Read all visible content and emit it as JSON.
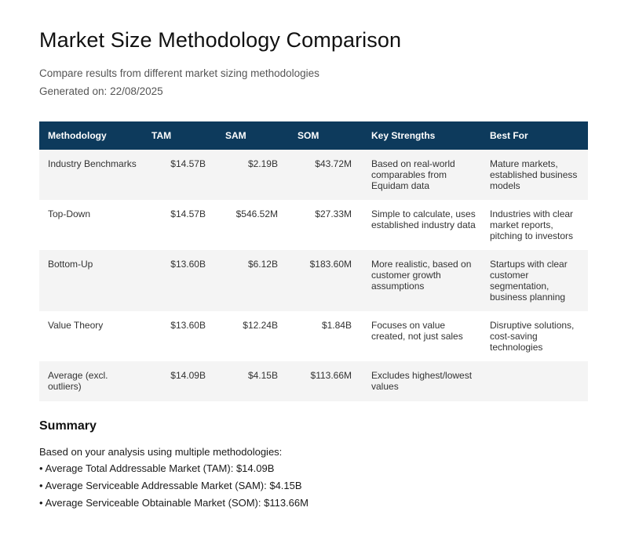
{
  "title": "Market Size Methodology Comparison",
  "subtitle": "Compare results from different market sizing methodologies",
  "generated": "Generated on: 22/08/2025",
  "table": {
    "headers": [
      "Methodology",
      "TAM",
      "SAM",
      "SOM",
      "Key Strengths",
      "Best For"
    ],
    "rows": [
      {
        "methodology": "Industry Benchmarks",
        "tam": "$14.57B",
        "sam": "$2.19B",
        "som": "$43.72M",
        "strengths": "Based on real-world comparables from Equidam data",
        "best_for": "Mature markets, established business models"
      },
      {
        "methodology": "Top-Down",
        "tam": "$14.57B",
        "sam": "$546.52M",
        "som": "$27.33M",
        "strengths": "Simple to calculate, uses established industry data",
        "best_for": "Industries with clear market reports, pitching to investors"
      },
      {
        "methodology": "Bottom-Up",
        "tam": "$13.60B",
        "sam": "$6.12B",
        "som": "$183.60M",
        "strengths": "More realistic, based on customer growth assumptions",
        "best_for": "Startups with clear customer segmentation, business planning"
      },
      {
        "methodology": "Value Theory",
        "tam": "$13.60B",
        "sam": "$12.24B",
        "som": "$1.84B",
        "strengths": "Focuses on value created, not just sales",
        "best_for": "Disruptive solutions, cost-saving technologies"
      },
      {
        "methodology": "Average (excl. outliers)",
        "tam": "$14.09B",
        "sam": "$4.15B",
        "som": "$113.66M",
        "strengths": "Excludes highest/lowest values",
        "best_for": ""
      }
    ]
  },
  "summary": {
    "heading": "Summary",
    "intro": "Based on your analysis using multiple methodologies:",
    "items": [
      "• Average Total Addressable Market (TAM): $14.09B",
      "• Average Serviceable Addressable Market (SAM): $4.15B",
      "• Average Serviceable Obtainable Market (SOM): $113.66M"
    ]
  },
  "colors": {
    "header_bg": "#0d3a5c",
    "row_shade": "#f4f4f4"
  }
}
